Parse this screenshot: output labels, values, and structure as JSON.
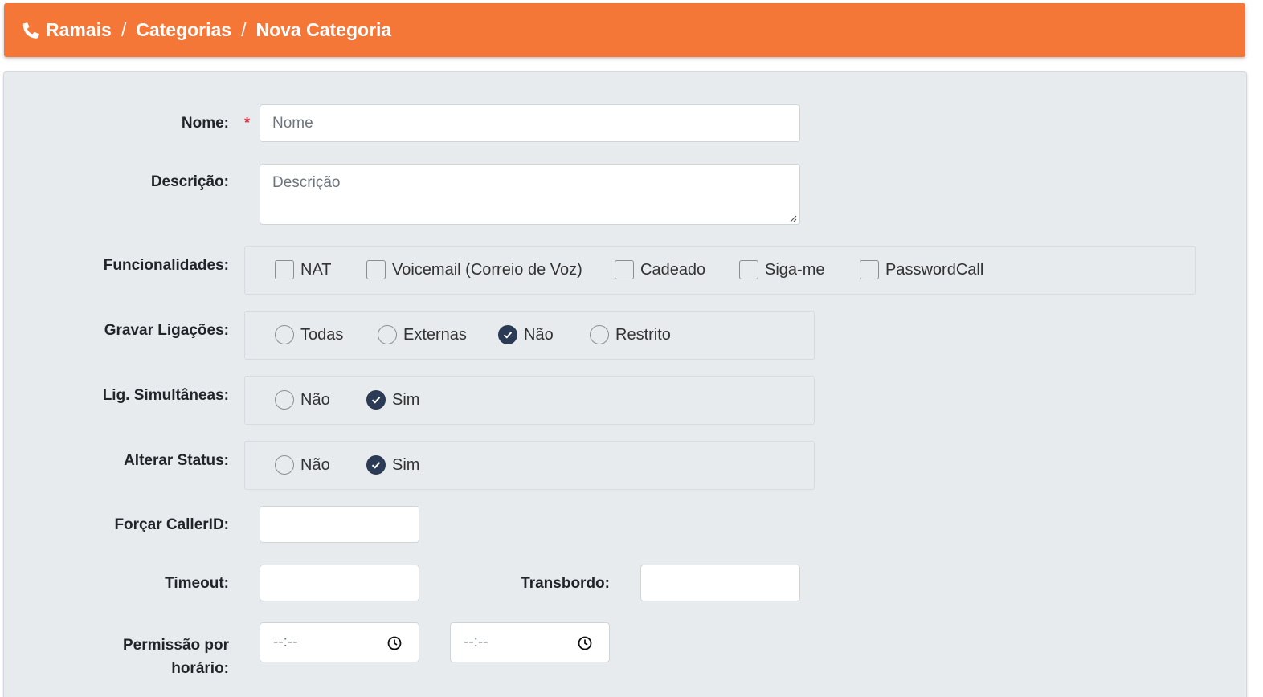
{
  "breadcrumb": {
    "items": [
      "Ramais",
      "Categorias",
      "Nova Categoria"
    ],
    "separator": "/",
    "icon": "phone-icon",
    "bg_color": "#f47738"
  },
  "form": {
    "nome": {
      "label": "Nome:",
      "placeholder": "Nome",
      "required_mark": "*"
    },
    "descricao": {
      "label": "Descrição:",
      "placeholder": "Descrição"
    },
    "funcionalidades": {
      "label": "Funcionalidades:",
      "options": [
        {
          "label": "NAT",
          "checked": false
        },
        {
          "label": "Voicemail (Correio de Voz)",
          "checked": false
        },
        {
          "label": "Cadeado",
          "checked": false
        },
        {
          "label": "Siga-me",
          "checked": false
        },
        {
          "label": "PasswordCall",
          "checked": false
        }
      ]
    },
    "gravar_ligacoes": {
      "label": "Gravar Ligações:",
      "options": [
        "Todas",
        "Externas",
        "Não",
        "Restrito"
      ],
      "selected": "Não"
    },
    "lig_simultaneas": {
      "label": "Lig. Simultâneas:",
      "options": [
        "Não",
        "Sim"
      ],
      "selected": "Sim"
    },
    "alterar_status": {
      "label": "Alterar Status:",
      "options": [
        "Não",
        "Sim"
      ],
      "selected": "Sim"
    },
    "forcar_callerid": {
      "label": "Forçar CallerID:",
      "value": ""
    },
    "timeout": {
      "label": "Timeout:",
      "value": ""
    },
    "transbordo": {
      "label": "Transbordo:",
      "value": ""
    },
    "permissao_horario": {
      "label_line1": "Permissão por",
      "label_line2": "horário:",
      "start_placeholder": "--:--",
      "end_placeholder": "--:--"
    }
  },
  "colors": {
    "accent": "#f47738",
    "radio_selected": "#2b3a55",
    "required": "#dc3545",
    "panel_bg": "#e8ebee"
  }
}
